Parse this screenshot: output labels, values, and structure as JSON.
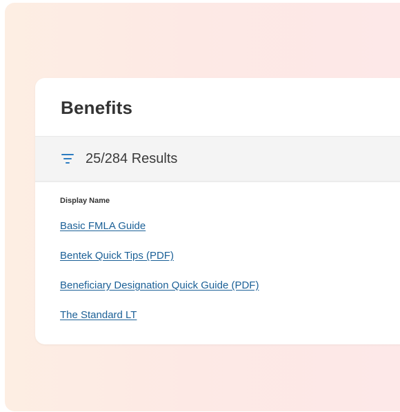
{
  "card": {
    "title": "Benefits"
  },
  "results": {
    "count_label": "25/284 Results"
  },
  "table": {
    "column_header": "Display Name",
    "rows": [
      "Basic FMLA Guide",
      "Bentek Quick Tips (PDF)",
      "Beneficiary Designation Quick Guide (PDF)",
      "The Standard LT"
    ]
  },
  "icons": {
    "filter": "filter-icon"
  },
  "colors": {
    "link": "#1a5f96",
    "filter_icon": "#2c7cc1",
    "title_text": "#333333"
  }
}
